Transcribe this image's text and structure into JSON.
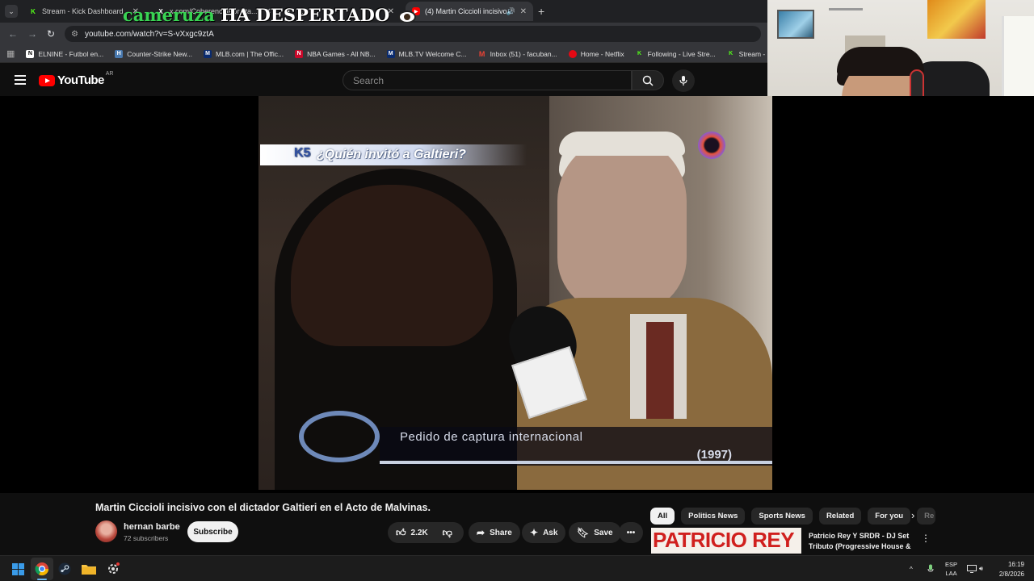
{
  "browser": {
    "tabs": [
      {
        "label": "Stream - Kick Dashboard",
        "icon": "kick-icon",
        "active": false
      },
      {
        "label": "x.com/CoherenciaPor/sta...",
        "icon": "x-icon",
        "active": false
      },
      {
        "label": "...",
        "icon": "x-icon",
        "active": false
      },
      {
        "label": "(4) Martin Ciccioli incisivo c",
        "icon": "youtube-icon",
        "active": true
      }
    ],
    "url": "youtube.com/watch?v=S-vXxgc9ztA",
    "bookmarks": [
      {
        "label": "ELNINE - Futbol en...",
        "icon": "elnine-icon"
      },
      {
        "label": "Counter-Strike New...",
        "icon": "hltv-icon"
      },
      {
        "label": "MLB.com | The Offic...",
        "icon": "mlb-icon"
      },
      {
        "label": "NBA Games - All NB...",
        "icon": "nba-icon"
      },
      {
        "label": "MLB.TV Welcome C...",
        "icon": "mlb-icon"
      },
      {
        "label": "Inbox (51) - facuban...",
        "icon": "gmail-icon"
      },
      {
        "label": "Home - Netflix",
        "icon": "netflix-icon"
      },
      {
        "label": "Following - Live Stre...",
        "icon": "kick-icon"
      },
      {
        "label": "Stream - Kick Dashb...",
        "icon": "kick-icon"
      }
    ]
  },
  "overlay": {
    "green": "cameruza",
    "white": "HA DESPERTADO"
  },
  "youtube": {
    "logo_text": "YouTube",
    "country": "AR",
    "search_placeholder": "Search"
  },
  "video_frame": {
    "chyron": "¿Quién invitó a Galtieri?",
    "chyron_logo": "K5",
    "lower_text": "Pedido de captura internacional",
    "year": "(1997)"
  },
  "video": {
    "title": "Martin Ciccioli incisivo con el dictador Galtieri en el Acto de Malvinas.",
    "channel": "hernan barbe",
    "subscribers": "72 subscribers",
    "subscribe_label": "Subscribe",
    "likes": "2.2K",
    "share_label": "Share",
    "ask_label": "Ask",
    "save_label": "Save"
  },
  "chips": [
    "All",
    "Politics News",
    "Sports News",
    "Related",
    "For you",
    "Re"
  ],
  "recommendation": {
    "thumb_text": "PATRICIO REY",
    "title": "Patricio Rey Y SRDR - DJ Set Tributo (Progressive House & ..."
  },
  "taskbar": {
    "language": "ESP",
    "layout": "LAA",
    "time": "16:19",
    "date": "2/8/2026"
  },
  "colors": {
    "accent": "#ff0000",
    "kick": "#53fc18",
    "overlay_green": "#39d353"
  }
}
